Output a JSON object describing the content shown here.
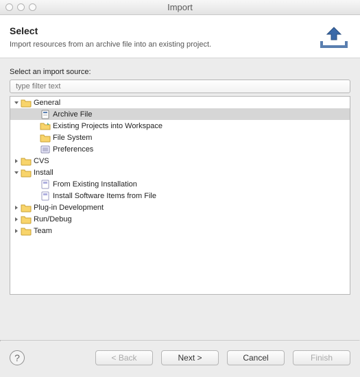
{
  "window": {
    "title": "Import"
  },
  "header": {
    "heading": "Select",
    "description": "Import resources from an archive file into an existing project."
  },
  "body": {
    "section_label": "Select an import source:",
    "filter_placeholder": "type filter text"
  },
  "tree": {
    "nodes": [
      {
        "label": "General",
        "type": "folder",
        "level": 0,
        "expanded": true,
        "selected": false,
        "icon": "folder-open-icon"
      },
      {
        "label": "Archive File",
        "type": "item",
        "level": 1,
        "expanded": null,
        "selected": true,
        "icon": "archive-file-icon"
      },
      {
        "label": "Existing Projects into Workspace",
        "type": "item",
        "level": 1,
        "expanded": null,
        "selected": false,
        "icon": "projects-icon"
      },
      {
        "label": "File System",
        "type": "item",
        "level": 1,
        "expanded": null,
        "selected": false,
        "icon": "folder-icon"
      },
      {
        "label": "Preferences",
        "type": "item",
        "level": 1,
        "expanded": null,
        "selected": false,
        "icon": "preferences-icon"
      },
      {
        "label": "CVS",
        "type": "folder",
        "level": 0,
        "expanded": false,
        "selected": false,
        "icon": "folder-icon"
      },
      {
        "label": "Install",
        "type": "folder",
        "level": 0,
        "expanded": true,
        "selected": false,
        "icon": "folder-open-icon"
      },
      {
        "label": "From Existing Installation",
        "type": "item",
        "level": 1,
        "expanded": null,
        "selected": false,
        "icon": "install-item-icon"
      },
      {
        "label": "Install Software Items from File",
        "type": "item",
        "level": 1,
        "expanded": null,
        "selected": false,
        "icon": "install-item-icon"
      },
      {
        "label": "Plug-in Development",
        "type": "folder",
        "level": 0,
        "expanded": false,
        "selected": false,
        "icon": "folder-icon"
      },
      {
        "label": "Run/Debug",
        "type": "folder",
        "level": 0,
        "expanded": false,
        "selected": false,
        "icon": "folder-icon"
      },
      {
        "label": "Team",
        "type": "folder",
        "level": 0,
        "expanded": false,
        "selected": false,
        "icon": "folder-icon"
      }
    ]
  },
  "buttons": {
    "back": "< Back",
    "next": "Next >",
    "cancel": "Cancel",
    "finish": "Finish"
  }
}
